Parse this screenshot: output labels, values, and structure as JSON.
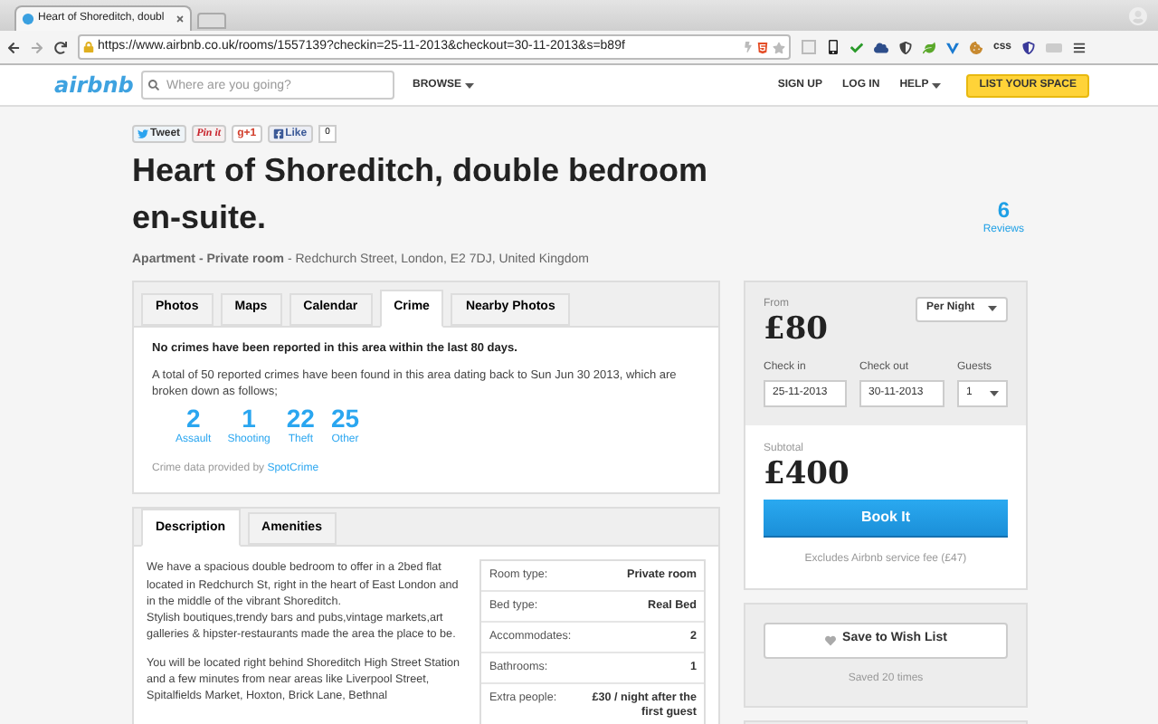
{
  "browser": {
    "tab_title": "Heart of Shoreditch, doubl",
    "url": "https://www.airbnb.co.uk/rooms/1557139?checkin=25-11-2013&checkout=30-11-2013&s=b89f",
    "extension_label": "css"
  },
  "header": {
    "logo": "airbnb",
    "search": {
      "placeholder": "Where are you going?"
    },
    "browse": "BROWSE",
    "nav": [
      {
        "label": "SIGN UP",
        "dropdown": false
      },
      {
        "label": "LOG IN",
        "dropdown": false
      },
      {
        "label": "HELP",
        "dropdown": true
      }
    ],
    "list_button": "LIST YOUR SPACE"
  },
  "social": [
    {
      "kind": "tweet",
      "label": "Tweet"
    },
    {
      "kind": "pin",
      "label": "Pin it"
    },
    {
      "kind": "plus",
      "label": "g+1"
    },
    {
      "kind": "like",
      "label": "Like"
    }
  ],
  "like_count": "0",
  "listing": {
    "title": "Heart of Shoreditch, double bedroom en-suite.",
    "subtitle": "**Apartment - Private room** - Redchurch Street, London, E2 7DJ, United Kingdom",
    "reviews_count": "6",
    "reviews_label": "Reviews"
  },
  "media_tabs": [
    {
      "label": "Photos",
      "selected": false
    },
    {
      "label": "Maps",
      "selected": false
    },
    {
      "label": "Calendar",
      "selected": false
    },
    {
      "label": "Crime",
      "selected": true
    },
    {
      "label": "Nearby Photos",
      "selected": false
    }
  ],
  "crime": {
    "headline": "No crimes have been reported in this area within the last 80 days.",
    "summary": "A total of 50 reported crimes have been found in this area dating back to Sun Jun 30 2013, which are broken down as follows;",
    "stats": [
      {
        "value": "2",
        "label": "Assault"
      },
      {
        "value": "1",
        "label": "Shooting"
      },
      {
        "value": "22",
        "label": "Theft"
      },
      {
        "value": "25",
        "label": "Other"
      }
    ],
    "credit": "Crime data provided by",
    "credit_link": "SpotCrime"
  },
  "info_tabs": [
    {
      "label": "Description",
      "selected": true
    },
    {
      "label": "Amenities",
      "selected": false
    }
  ],
  "description": [
    "We have a spacious double bedroom to offer in a 2bed flat located in Redchurch St, right in the heart of East London and in the middle of the vibrant Shoreditch.\nStylish boutiques,trendy bars and pubs,vintage markets,art galleries & hipster-restaurants made the area the place to be.",
    "You will be located right behind Shoreditch High Street Station and a few minutes from near areas like Liverpool Street, Spitalfields Market, Hoxton, Brick Lane, Bethnal"
  ],
  "details": [
    {
      "label": "Room type:",
      "value": "Private room"
    },
    {
      "label": "Bed type:",
      "value": "Real Bed"
    },
    {
      "label": "Accommodates:",
      "value": "2"
    },
    {
      "label": "Bathrooms:",
      "value": "1"
    },
    {
      "label": "Extra people:",
      "value": "£30 / night after the first guest"
    }
  ],
  "booking": {
    "from_label": "From",
    "price": "£80",
    "period": "Per Night",
    "checkin_label": "Check in",
    "checkin": "25-11-2013",
    "checkout_label": "Check out",
    "checkout": "30-11-2013",
    "guests_label": "Guests",
    "guests": "1",
    "subtotal_label": "Subtotal",
    "subtotal": "£400",
    "book_button": "Book It",
    "fee_note": "Excludes Airbnb service fee (£47)"
  },
  "wishlist": {
    "button": "Save to Wish List",
    "saved": "Saved 20 times"
  }
}
